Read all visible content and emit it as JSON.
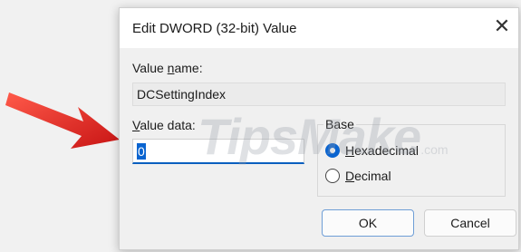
{
  "dialog": {
    "title": "Edit DWORD (32-bit) Value",
    "close_symbol": "✕",
    "value_name_label_pre": "Value ",
    "value_name_label_u": "n",
    "value_name_label_post": "ame:",
    "value_name": "DCSettingIndex",
    "value_data_label_pre": "",
    "value_data_label_u": "V",
    "value_data_label_post": "alue data:",
    "value_data": "0",
    "base": {
      "title": "Base",
      "options": [
        {
          "label_u": "H",
          "label_rest": "exadecimal",
          "selected": true
        },
        {
          "label_u": "D",
          "label_rest": "ecimal",
          "selected": false
        }
      ]
    },
    "ok_label": "OK",
    "cancel_label": "Cancel"
  },
  "watermark": {
    "text": "TipsMake",
    "suffix": ".com"
  },
  "colors": {
    "accent": "#0a64d0",
    "arrow": "#e02020"
  }
}
